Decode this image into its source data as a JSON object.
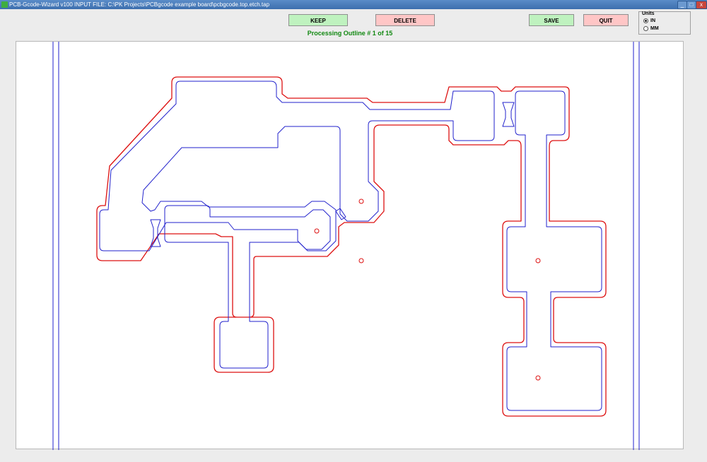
{
  "window": {
    "title": "PCB-Gcode-Wizard v100  INPUT FILE:  C:\\PK Projects\\PCBgcode example board\\pcbgcode.top.etch.tap",
    "minimize_glyph": "_",
    "maximize_glyph": "□",
    "close_glyph": "x"
  },
  "toolbar": {
    "keep_label": "KEEP",
    "delete_label": "DELETE",
    "save_label": "SAVE",
    "quit_label": "QUIT"
  },
  "status": {
    "text": "Processing Outline #  1  of   15"
  },
  "units": {
    "label": "Units",
    "options": [
      "IN",
      "MM"
    ],
    "selected": "IN"
  },
  "colors": {
    "outline_selected": "#dd1111",
    "outline_other": "#2222cc",
    "keep_button": "#bff2bf",
    "quit_button": "#ffc6c6",
    "status_text": "#118811"
  }
}
